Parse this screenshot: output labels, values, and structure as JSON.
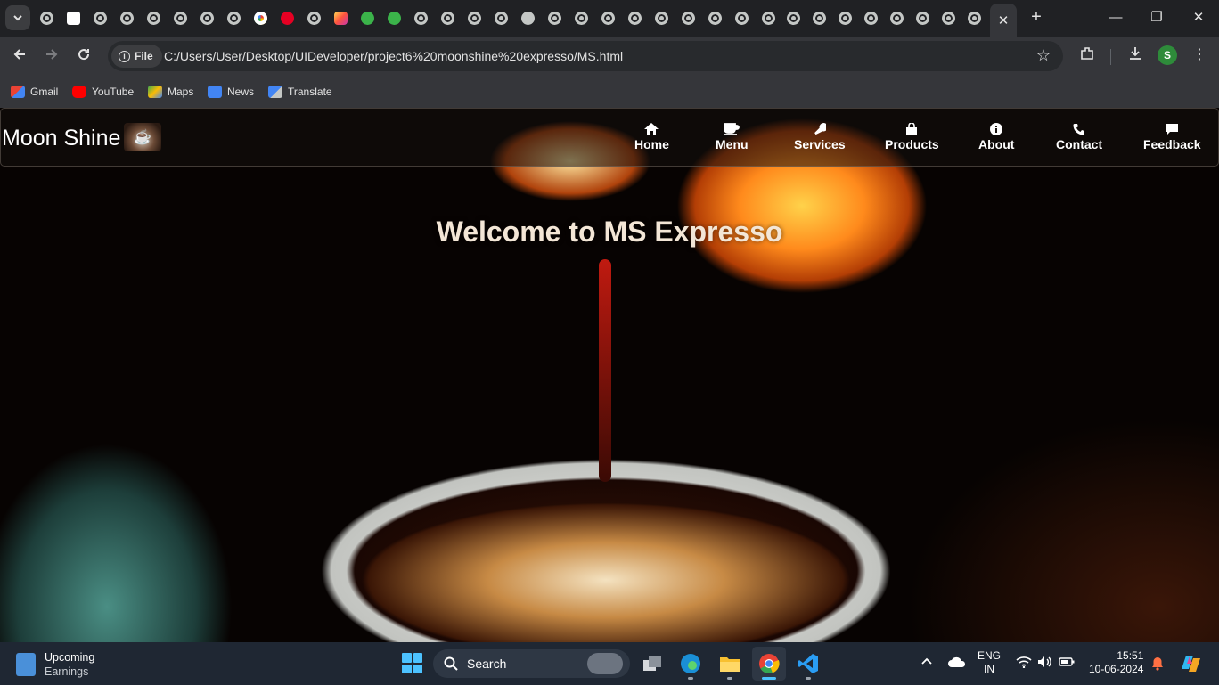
{
  "browser": {
    "active_tab_close": "✕",
    "new_tab": "+",
    "window": {
      "minimize": "—",
      "restore": "❐",
      "close": "✕"
    },
    "address": {
      "chip_label": "File",
      "url": "C:/Users/User/Desktop/UIDeveloper/project6%20moonshine%20expresso/MS.html"
    },
    "profile_initial": "S",
    "bookmarks": [
      "Gmail",
      "YouTube",
      "Maps",
      "News",
      "Translate"
    ]
  },
  "site": {
    "brand": "Moon Shine",
    "nav": [
      {
        "label": "Home",
        "icon": "home-icon"
      },
      {
        "label": "Menu",
        "icon": "coffee-icon"
      },
      {
        "label": "Services",
        "icon": "wrench-icon"
      },
      {
        "label": "Products",
        "icon": "shopping-bag-icon"
      },
      {
        "label": "About",
        "icon": "info-icon"
      },
      {
        "label": "Contact",
        "icon": "phone-icon"
      },
      {
        "label": "Feedback",
        "icon": "comment-icon"
      }
    ],
    "welcome": "Welcome to MS Expresso"
  },
  "taskbar": {
    "weather_title": "Upcoming",
    "weather_sub": "Earnings",
    "search_label": "Search",
    "lang_top": "ENG",
    "lang_bottom": "IN",
    "time": "15:51",
    "date": "10-06-2024"
  }
}
